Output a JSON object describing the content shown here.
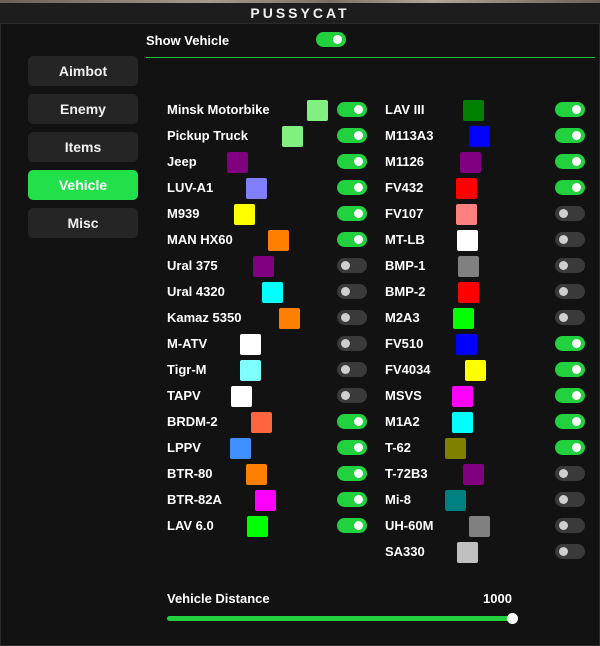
{
  "window": {
    "title": "PUSSYCAT"
  },
  "sidebar": {
    "items": [
      {
        "label": "Aimbot",
        "active": false
      },
      {
        "label": "Enemy",
        "active": false
      },
      {
        "label": "Items",
        "active": false
      },
      {
        "label": "Vehicle",
        "active": true
      },
      {
        "label": "Misc",
        "active": false
      }
    ]
  },
  "colors": {
    "accent": "#22d13e",
    "toggle_off": "#3a3a3a"
  },
  "show_vehicle": {
    "label": "Show Vehicle",
    "on": true
  },
  "left_vehicles": [
    {
      "name": "Minsk Motorbike",
      "color": "#80f080",
      "enabled": true
    },
    {
      "name": "Pickup Truck",
      "color": "#80f080",
      "enabled": true
    },
    {
      "name": "Jeep",
      "color": "#800080",
      "enabled": true
    },
    {
      "name": "LUV-A1",
      "color": "#8080ff",
      "enabled": true
    },
    {
      "name": "M939",
      "color": "#ffff00",
      "enabled": true
    },
    {
      "name": "MAN HX60",
      "color": "#ff8000",
      "enabled": true
    },
    {
      "name": "Ural 375",
      "color": "#800080",
      "enabled": false
    },
    {
      "name": "Ural 4320",
      "color": "#00ffff",
      "enabled": false
    },
    {
      "name": "Kamaz 5350",
      "color": "#ff8000",
      "enabled": false
    },
    {
      "name": "M-ATV",
      "color": "#ffffff",
      "enabled": false
    },
    {
      "name": "Tigr-M",
      "color": "#80ffff",
      "enabled": false
    },
    {
      "name": "TAPV",
      "color": "#ffffff",
      "enabled": false
    },
    {
      "name": "BRDM-2",
      "color": "#ff6640",
      "enabled": true
    },
    {
      "name": "LPPV",
      "color": "#4090ff",
      "enabled": true
    },
    {
      "name": "BTR-80",
      "color": "#ff8000",
      "enabled": true
    },
    {
      "name": "BTR-82A",
      "color": "#ff00ff",
      "enabled": true
    },
    {
      "name": "LAV 6.0",
      "color": "#00ff00",
      "enabled": true
    }
  ],
  "right_vehicles": [
    {
      "name": "LAV III",
      "color": "#008000",
      "enabled": true
    },
    {
      "name": "M113A3",
      "color": "#0000ff",
      "enabled": true
    },
    {
      "name": "M1126",
      "color": "#800080",
      "enabled": true
    },
    {
      "name": "FV432",
      "color": "#ff0000",
      "enabled": true
    },
    {
      "name": "FV107",
      "color": "#ff8080",
      "enabled": false
    },
    {
      "name": "MT-LB",
      "color": "#ffffff",
      "enabled": false
    },
    {
      "name": "BMP-1",
      "color": "#808080",
      "enabled": false
    },
    {
      "name": "BMP-2",
      "color": "#ff0000",
      "enabled": false
    },
    {
      "name": "M2A3",
      "color": "#00ff00",
      "enabled": false
    },
    {
      "name": "FV510",
      "color": "#0000ff",
      "enabled": true
    },
    {
      "name": "FV4034",
      "color": "#ffff00",
      "enabled": true
    },
    {
      "name": "MSVS",
      "color": "#ff00ff",
      "enabled": true
    },
    {
      "name": "M1A2",
      "color": "#00ffff",
      "enabled": true
    },
    {
      "name": "T-62",
      "color": "#808000",
      "enabled": true
    },
    {
      "name": "T-72B3",
      "color": "#800080",
      "enabled": false
    },
    {
      "name": "Mi-8",
      "color": "#008080",
      "enabled": false
    },
    {
      "name": "UH-60M",
      "color": "#808080",
      "enabled": false
    },
    {
      "name": "SA330",
      "color": "#c0c0c0",
      "enabled": false
    }
  ],
  "distance": {
    "label": "Vehicle Distance",
    "value": "1000",
    "fraction": 1.0
  }
}
